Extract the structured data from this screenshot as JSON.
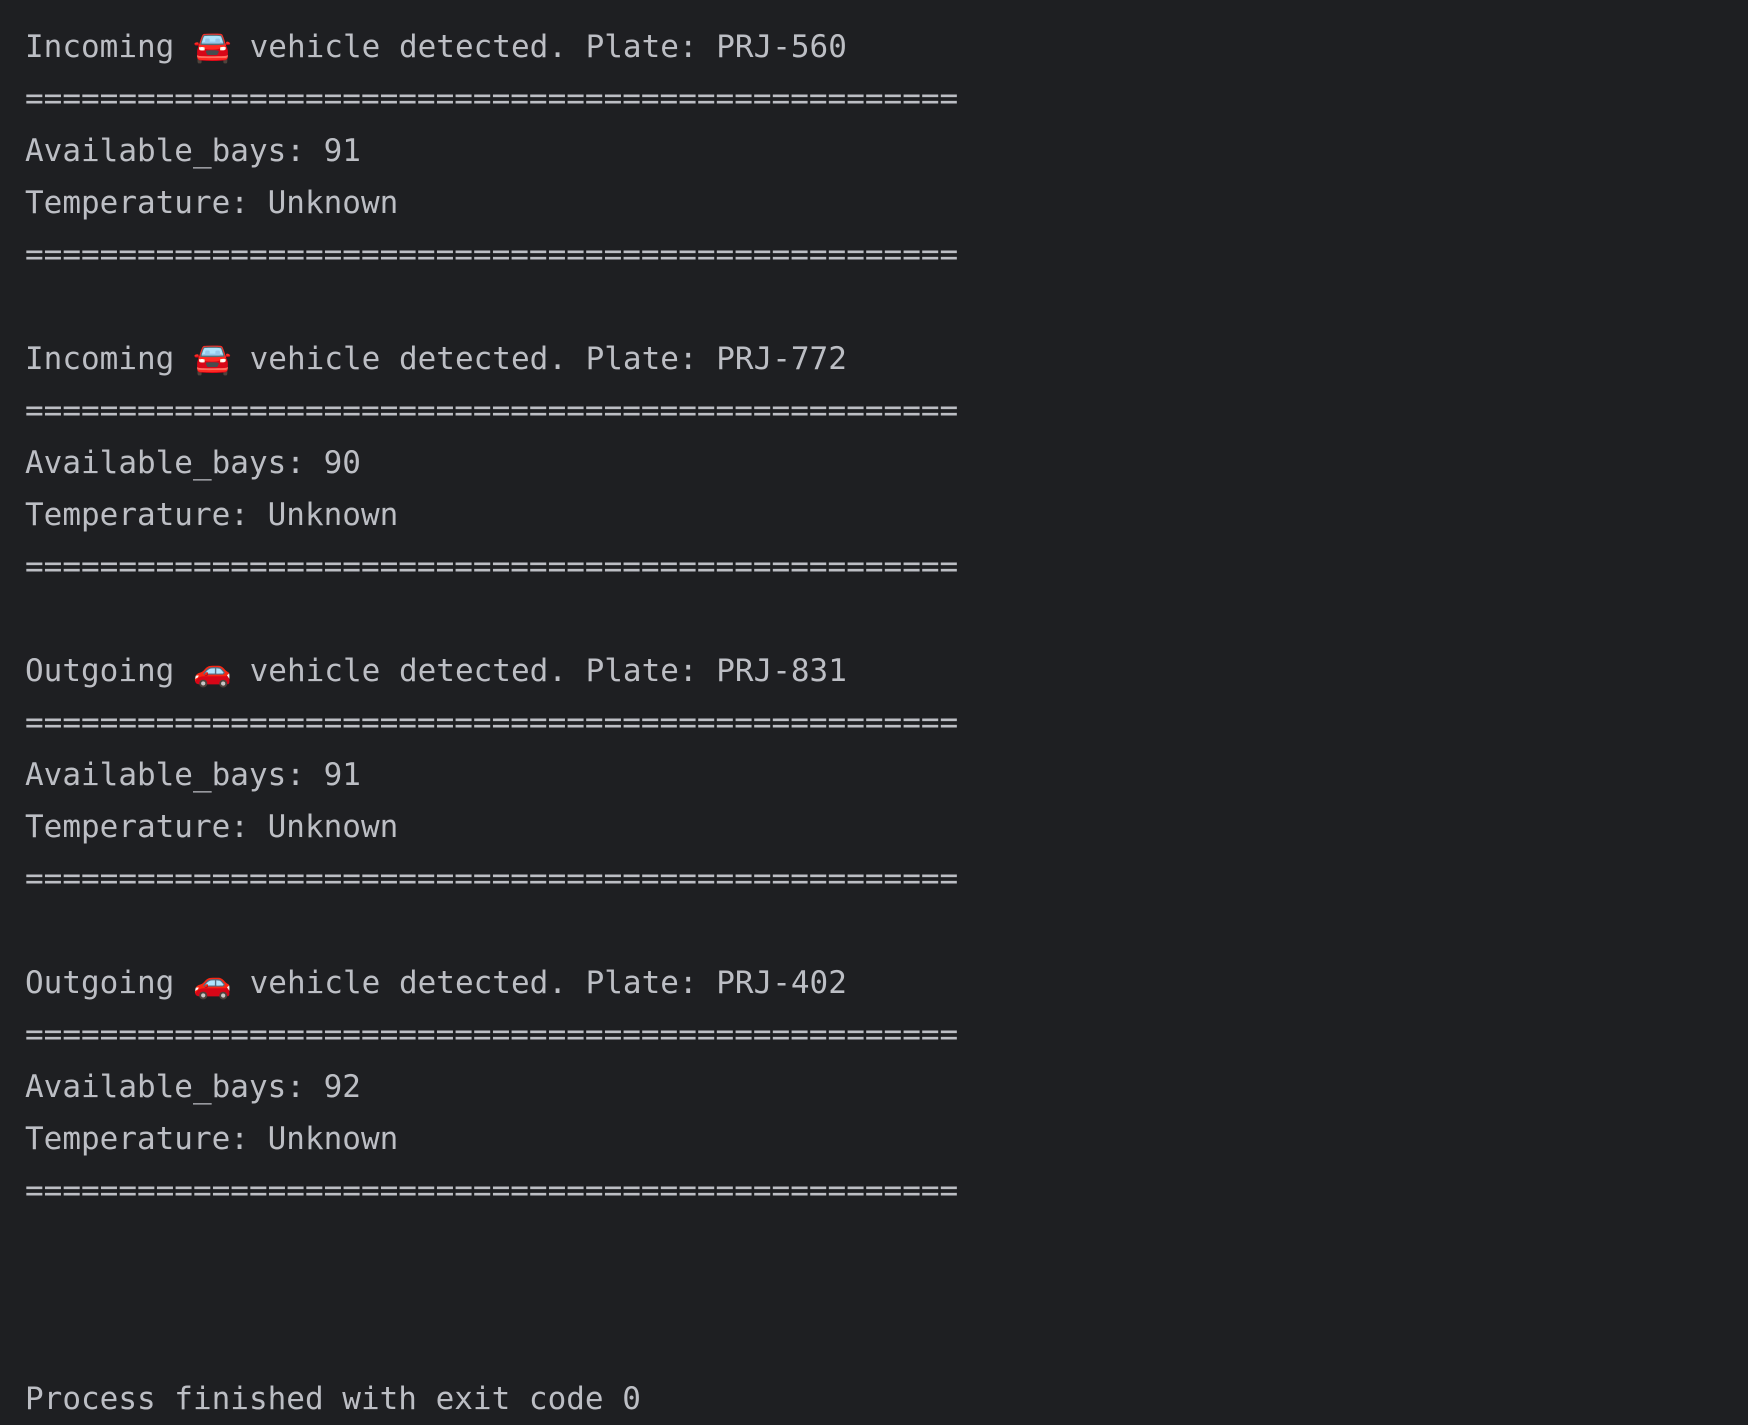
{
  "console": {
    "separator": "==================================================",
    "entries": [
      {
        "direction": "Incoming",
        "icon": "🚘",
        "message": " vehicle detected. Plate: PRJ-560",
        "bays": "Available_bays: 91",
        "temperature": "Temperature: Unknown"
      },
      {
        "direction": "Incoming",
        "icon": "🚘",
        "message": " vehicle detected. Plate: PRJ-772",
        "bays": "Available_bays: 90",
        "temperature": "Temperature: Unknown"
      },
      {
        "direction": "Outgoing",
        "icon": "🚗",
        "message": " vehicle detected. Plate: PRJ-831",
        "bays": "Available_bays: 91",
        "temperature": "Temperature: Unknown"
      },
      {
        "direction": "Outgoing",
        "icon": "🚗",
        "message": " vehicle detected. Plate: PRJ-402",
        "bays": "Available_bays: 92",
        "temperature": "Temperature: Unknown"
      }
    ],
    "exit_message": "Process finished with exit code 0"
  }
}
